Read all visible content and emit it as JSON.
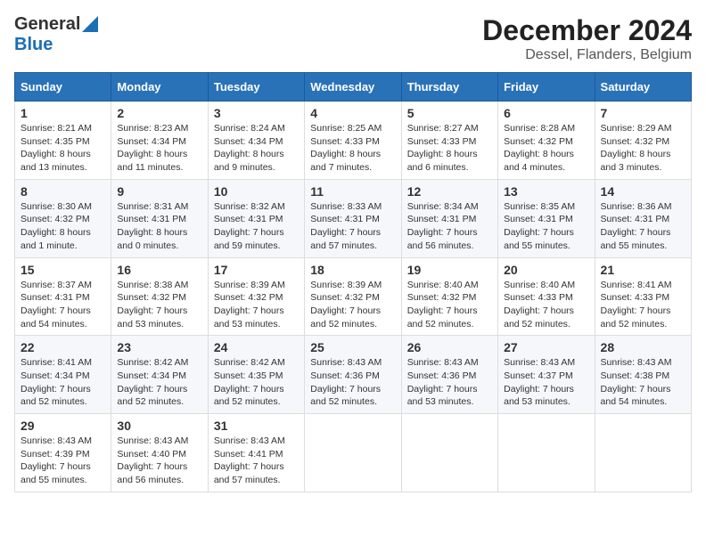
{
  "logo": {
    "line1": "General",
    "line2": "Blue"
  },
  "title": "December 2024",
  "subtitle": "Dessel, Flanders, Belgium",
  "weekdays": [
    "Sunday",
    "Monday",
    "Tuesday",
    "Wednesday",
    "Thursday",
    "Friday",
    "Saturday"
  ],
  "weeks": [
    [
      {
        "day": "1",
        "sunrise": "8:21 AM",
        "sunset": "4:35 PM",
        "daylight": "8 hours and 13 minutes."
      },
      {
        "day": "2",
        "sunrise": "8:23 AM",
        "sunset": "4:34 PM",
        "daylight": "8 hours and 11 minutes."
      },
      {
        "day": "3",
        "sunrise": "8:24 AM",
        "sunset": "4:34 PM",
        "daylight": "8 hours and 9 minutes."
      },
      {
        "day": "4",
        "sunrise": "8:25 AM",
        "sunset": "4:33 PM",
        "daylight": "8 hours and 7 minutes."
      },
      {
        "day": "5",
        "sunrise": "8:27 AM",
        "sunset": "4:33 PM",
        "daylight": "8 hours and 6 minutes."
      },
      {
        "day": "6",
        "sunrise": "8:28 AM",
        "sunset": "4:32 PM",
        "daylight": "8 hours and 4 minutes."
      },
      {
        "day": "7",
        "sunrise": "8:29 AM",
        "sunset": "4:32 PM",
        "daylight": "8 hours and 3 minutes."
      }
    ],
    [
      {
        "day": "8",
        "sunrise": "8:30 AM",
        "sunset": "4:32 PM",
        "daylight": "8 hours and 1 minute."
      },
      {
        "day": "9",
        "sunrise": "8:31 AM",
        "sunset": "4:31 PM",
        "daylight": "8 hours and 0 minutes."
      },
      {
        "day": "10",
        "sunrise": "8:32 AM",
        "sunset": "4:31 PM",
        "daylight": "7 hours and 59 minutes."
      },
      {
        "day": "11",
        "sunrise": "8:33 AM",
        "sunset": "4:31 PM",
        "daylight": "7 hours and 57 minutes."
      },
      {
        "day": "12",
        "sunrise": "8:34 AM",
        "sunset": "4:31 PM",
        "daylight": "7 hours and 56 minutes."
      },
      {
        "day": "13",
        "sunrise": "8:35 AM",
        "sunset": "4:31 PM",
        "daylight": "7 hours and 55 minutes."
      },
      {
        "day": "14",
        "sunrise": "8:36 AM",
        "sunset": "4:31 PM",
        "daylight": "7 hours and 55 minutes."
      }
    ],
    [
      {
        "day": "15",
        "sunrise": "8:37 AM",
        "sunset": "4:31 PM",
        "daylight": "7 hours and 54 minutes."
      },
      {
        "day": "16",
        "sunrise": "8:38 AM",
        "sunset": "4:32 PM",
        "daylight": "7 hours and 53 minutes."
      },
      {
        "day": "17",
        "sunrise": "8:39 AM",
        "sunset": "4:32 PM",
        "daylight": "7 hours and 53 minutes."
      },
      {
        "day": "18",
        "sunrise": "8:39 AM",
        "sunset": "4:32 PM",
        "daylight": "7 hours and 52 minutes."
      },
      {
        "day": "19",
        "sunrise": "8:40 AM",
        "sunset": "4:32 PM",
        "daylight": "7 hours and 52 minutes."
      },
      {
        "day": "20",
        "sunrise": "8:40 AM",
        "sunset": "4:33 PM",
        "daylight": "7 hours and 52 minutes."
      },
      {
        "day": "21",
        "sunrise": "8:41 AM",
        "sunset": "4:33 PM",
        "daylight": "7 hours and 52 minutes."
      }
    ],
    [
      {
        "day": "22",
        "sunrise": "8:41 AM",
        "sunset": "4:34 PM",
        "daylight": "7 hours and 52 minutes."
      },
      {
        "day": "23",
        "sunrise": "8:42 AM",
        "sunset": "4:34 PM",
        "daylight": "7 hours and 52 minutes."
      },
      {
        "day": "24",
        "sunrise": "8:42 AM",
        "sunset": "4:35 PM",
        "daylight": "7 hours and 52 minutes."
      },
      {
        "day": "25",
        "sunrise": "8:43 AM",
        "sunset": "4:36 PM",
        "daylight": "7 hours and 52 minutes."
      },
      {
        "day": "26",
        "sunrise": "8:43 AM",
        "sunset": "4:36 PM",
        "daylight": "7 hours and 53 minutes."
      },
      {
        "day": "27",
        "sunrise": "8:43 AM",
        "sunset": "4:37 PM",
        "daylight": "7 hours and 53 minutes."
      },
      {
        "day": "28",
        "sunrise": "8:43 AM",
        "sunset": "4:38 PM",
        "daylight": "7 hours and 54 minutes."
      }
    ],
    [
      {
        "day": "29",
        "sunrise": "8:43 AM",
        "sunset": "4:39 PM",
        "daylight": "7 hours and 55 minutes."
      },
      {
        "day": "30",
        "sunrise": "8:43 AM",
        "sunset": "4:40 PM",
        "daylight": "7 hours and 56 minutes."
      },
      {
        "day": "31",
        "sunrise": "8:43 AM",
        "sunset": "4:41 PM",
        "daylight": "7 hours and 57 minutes."
      },
      null,
      null,
      null,
      null
    ]
  ],
  "labels": {
    "sunrise": "Sunrise:",
    "sunset": "Sunset:",
    "daylight": "Daylight:"
  }
}
